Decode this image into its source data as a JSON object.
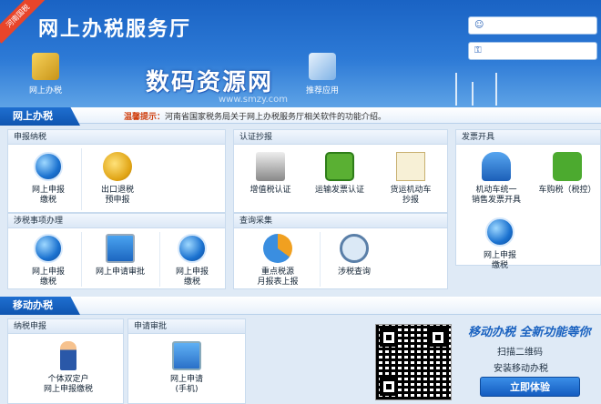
{
  "header": {
    "ribbon": "河南国税",
    "title": "网上办税服务厅",
    "login": {
      "user_placeholder": "",
      "password_placeholder": ""
    },
    "nav": [
      {
        "label": "网上办税",
        "icon": "tax-icon"
      },
      {
        "label": "推荐应用",
        "icon": "apps-icon"
      }
    ]
  },
  "watermark": {
    "text": "数码资源网",
    "url": "www.smzy.com"
  },
  "section_online": {
    "tab": "网上办税",
    "notice_label": "温馨提示：",
    "notice_text": "河南省国家税务局关于网上办税服务厅相关软件的功能介绍。"
  },
  "panels": {
    "declare": {
      "title": "申报纳税",
      "items": [
        "网上申报\n缴税",
        "出口退税\n预申报"
      ]
    },
    "certify": {
      "title": "认证抄报",
      "items": [
        "增值税认证",
        "运输发票认证",
        "货运机动车\n抄报"
      ]
    },
    "invoice": {
      "title": "发票开具",
      "items": [
        "机动车统一\n销售发票开具",
        "车购税（税控）",
        "网上申报\n缴税"
      ]
    },
    "matters": {
      "title": "涉税事项办理",
      "items": [
        "网上申报\n缴税",
        "网上申请审批",
        "网上申报\n缴税"
      ]
    },
    "query": {
      "title": "查询采集",
      "items": [
        "重点税源\n月报表上报",
        "涉税查询"
      ]
    }
  },
  "section_mobile": {
    "tab": "移动办税",
    "panels": {
      "tax": {
        "title": "纳税申报",
        "items": [
          "个体双定户\n网上申报缴税"
        ]
      },
      "approve": {
        "title": "申请审批",
        "items": [
          "网上申请\n(手机)"
        ]
      }
    },
    "promo_title": "移动办税 全新功能等你",
    "promo_lines": [
      "扫描二维码",
      "安装移动办税"
    ],
    "button": "立即体验"
  }
}
